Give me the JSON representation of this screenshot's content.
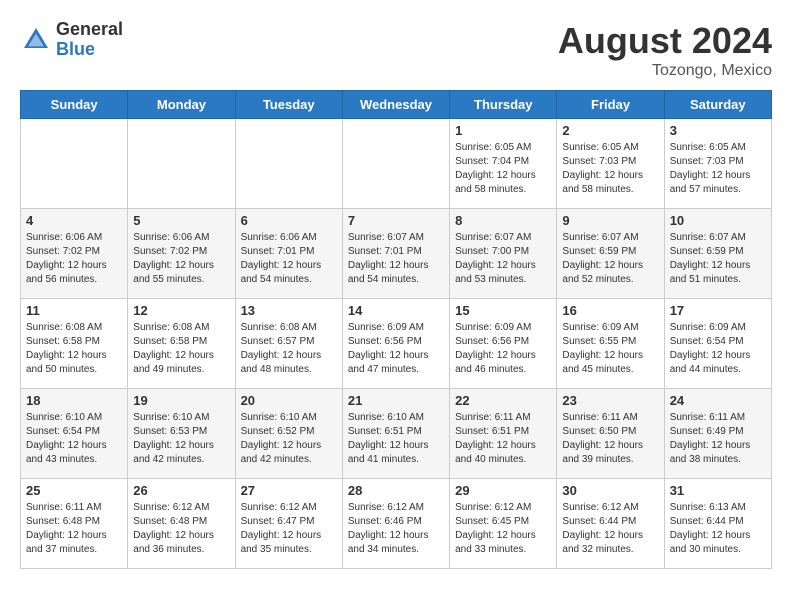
{
  "header": {
    "logo_general": "General",
    "logo_blue": "Blue",
    "month_title": "August 2024",
    "location": "Tozongo, Mexico"
  },
  "days_of_week": [
    "Sunday",
    "Monday",
    "Tuesday",
    "Wednesday",
    "Thursday",
    "Friday",
    "Saturday"
  ],
  "weeks": [
    [
      {
        "day": "",
        "info": ""
      },
      {
        "day": "",
        "info": ""
      },
      {
        "day": "",
        "info": ""
      },
      {
        "day": "",
        "info": ""
      },
      {
        "day": "1",
        "info": "Sunrise: 6:05 AM\nSunset: 7:04 PM\nDaylight: 12 hours\nand 58 minutes."
      },
      {
        "day": "2",
        "info": "Sunrise: 6:05 AM\nSunset: 7:03 PM\nDaylight: 12 hours\nand 58 minutes."
      },
      {
        "day": "3",
        "info": "Sunrise: 6:05 AM\nSunset: 7:03 PM\nDaylight: 12 hours\nand 57 minutes."
      }
    ],
    [
      {
        "day": "4",
        "info": "Sunrise: 6:06 AM\nSunset: 7:02 PM\nDaylight: 12 hours\nand 56 minutes."
      },
      {
        "day": "5",
        "info": "Sunrise: 6:06 AM\nSunset: 7:02 PM\nDaylight: 12 hours\nand 55 minutes."
      },
      {
        "day": "6",
        "info": "Sunrise: 6:06 AM\nSunset: 7:01 PM\nDaylight: 12 hours\nand 54 minutes."
      },
      {
        "day": "7",
        "info": "Sunrise: 6:07 AM\nSunset: 7:01 PM\nDaylight: 12 hours\nand 54 minutes."
      },
      {
        "day": "8",
        "info": "Sunrise: 6:07 AM\nSunset: 7:00 PM\nDaylight: 12 hours\nand 53 minutes."
      },
      {
        "day": "9",
        "info": "Sunrise: 6:07 AM\nSunset: 6:59 PM\nDaylight: 12 hours\nand 52 minutes."
      },
      {
        "day": "10",
        "info": "Sunrise: 6:07 AM\nSunset: 6:59 PM\nDaylight: 12 hours\nand 51 minutes."
      }
    ],
    [
      {
        "day": "11",
        "info": "Sunrise: 6:08 AM\nSunset: 6:58 PM\nDaylight: 12 hours\nand 50 minutes."
      },
      {
        "day": "12",
        "info": "Sunrise: 6:08 AM\nSunset: 6:58 PM\nDaylight: 12 hours\nand 49 minutes."
      },
      {
        "day": "13",
        "info": "Sunrise: 6:08 AM\nSunset: 6:57 PM\nDaylight: 12 hours\nand 48 minutes."
      },
      {
        "day": "14",
        "info": "Sunrise: 6:09 AM\nSunset: 6:56 PM\nDaylight: 12 hours\nand 47 minutes."
      },
      {
        "day": "15",
        "info": "Sunrise: 6:09 AM\nSunset: 6:56 PM\nDaylight: 12 hours\nand 46 minutes."
      },
      {
        "day": "16",
        "info": "Sunrise: 6:09 AM\nSunset: 6:55 PM\nDaylight: 12 hours\nand 45 minutes."
      },
      {
        "day": "17",
        "info": "Sunrise: 6:09 AM\nSunset: 6:54 PM\nDaylight: 12 hours\nand 44 minutes."
      }
    ],
    [
      {
        "day": "18",
        "info": "Sunrise: 6:10 AM\nSunset: 6:54 PM\nDaylight: 12 hours\nand 43 minutes."
      },
      {
        "day": "19",
        "info": "Sunrise: 6:10 AM\nSunset: 6:53 PM\nDaylight: 12 hours\nand 42 minutes."
      },
      {
        "day": "20",
        "info": "Sunrise: 6:10 AM\nSunset: 6:52 PM\nDaylight: 12 hours\nand 42 minutes."
      },
      {
        "day": "21",
        "info": "Sunrise: 6:10 AM\nSunset: 6:51 PM\nDaylight: 12 hours\nand 41 minutes."
      },
      {
        "day": "22",
        "info": "Sunrise: 6:11 AM\nSunset: 6:51 PM\nDaylight: 12 hours\nand 40 minutes."
      },
      {
        "day": "23",
        "info": "Sunrise: 6:11 AM\nSunset: 6:50 PM\nDaylight: 12 hours\nand 39 minutes."
      },
      {
        "day": "24",
        "info": "Sunrise: 6:11 AM\nSunset: 6:49 PM\nDaylight: 12 hours\nand 38 minutes."
      }
    ],
    [
      {
        "day": "25",
        "info": "Sunrise: 6:11 AM\nSunset: 6:48 PM\nDaylight: 12 hours\nand 37 minutes."
      },
      {
        "day": "26",
        "info": "Sunrise: 6:12 AM\nSunset: 6:48 PM\nDaylight: 12 hours\nand 36 minutes."
      },
      {
        "day": "27",
        "info": "Sunrise: 6:12 AM\nSunset: 6:47 PM\nDaylight: 12 hours\nand 35 minutes."
      },
      {
        "day": "28",
        "info": "Sunrise: 6:12 AM\nSunset: 6:46 PM\nDaylight: 12 hours\nand 34 minutes."
      },
      {
        "day": "29",
        "info": "Sunrise: 6:12 AM\nSunset: 6:45 PM\nDaylight: 12 hours\nand 33 minutes."
      },
      {
        "day": "30",
        "info": "Sunrise: 6:12 AM\nSunset: 6:44 PM\nDaylight: 12 hours\nand 32 minutes."
      },
      {
        "day": "31",
        "info": "Sunrise: 6:13 AM\nSunset: 6:44 PM\nDaylight: 12 hours\nand 30 minutes."
      }
    ]
  ]
}
